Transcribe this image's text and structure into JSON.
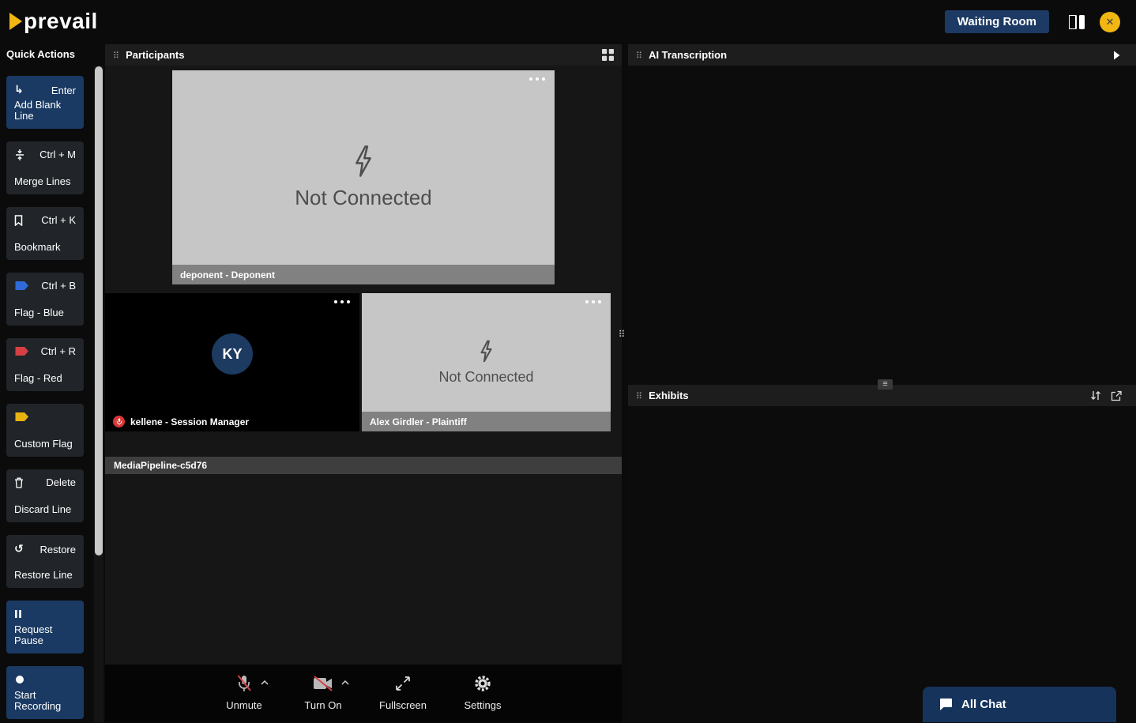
{
  "colors": {
    "navy": "#1c3a63",
    "brand_yellow": "#f2b613",
    "flag_blue": "#2e6bd8",
    "flag_red": "#d64045",
    "flag_yellow": "#e9b411",
    "muted_red": "#d93838"
  },
  "topbar": {
    "logo_text": "prevail",
    "waiting_room_label": "Waiting Room"
  },
  "quick_actions": {
    "title": "Quick Actions",
    "items": [
      {
        "icon": "enter-arrow-icon",
        "shortcut": "Enter",
        "label": "Add Blank Line"
      },
      {
        "icon": "merge-icon",
        "shortcut": "Ctrl + M",
        "label": "Merge Lines"
      },
      {
        "icon": "bookmark-icon",
        "shortcut": "Ctrl + K",
        "label": "Bookmark"
      },
      {
        "icon": "flag-blue-icon",
        "shortcut": "Ctrl + B",
        "label": "Flag - Blue"
      },
      {
        "icon": "flag-red-icon",
        "shortcut": "Ctrl + R",
        "label": "Flag - Red"
      },
      {
        "icon": "flag-yellow-icon",
        "shortcut": "",
        "label": "Custom Flag"
      },
      {
        "icon": "trash-icon",
        "shortcut": "Delete",
        "label": "Discard Line"
      },
      {
        "icon": "restore-icon",
        "shortcut": "Restore",
        "label": "Restore Line"
      },
      {
        "icon": "pause-icon",
        "shortcut": "",
        "label": "Request Pause"
      },
      {
        "icon": "record-icon",
        "shortcut": "",
        "label": "Start Recording"
      }
    ]
  },
  "participants": {
    "title": "Participants",
    "tiles": [
      {
        "status": "Not Connected",
        "name": "deponent - Deponent"
      },
      {
        "avatar_initials": "KY",
        "name": "kellene - Session Manager",
        "muted": true
      },
      {
        "status": "Not Connected",
        "name": "Alex Girdler - Plaintiff"
      }
    ],
    "media_pipeline_label": "MediaPipeline-c5d76",
    "controls": {
      "unmute": "Unmute",
      "turn_on": "Turn On",
      "fullscreen": "Fullscreen",
      "settings": "Settings"
    }
  },
  "transcription": {
    "title": "AI Transcription"
  },
  "exhibits": {
    "title": "Exhibits"
  },
  "chat": {
    "all_chat_label": "All Chat"
  }
}
